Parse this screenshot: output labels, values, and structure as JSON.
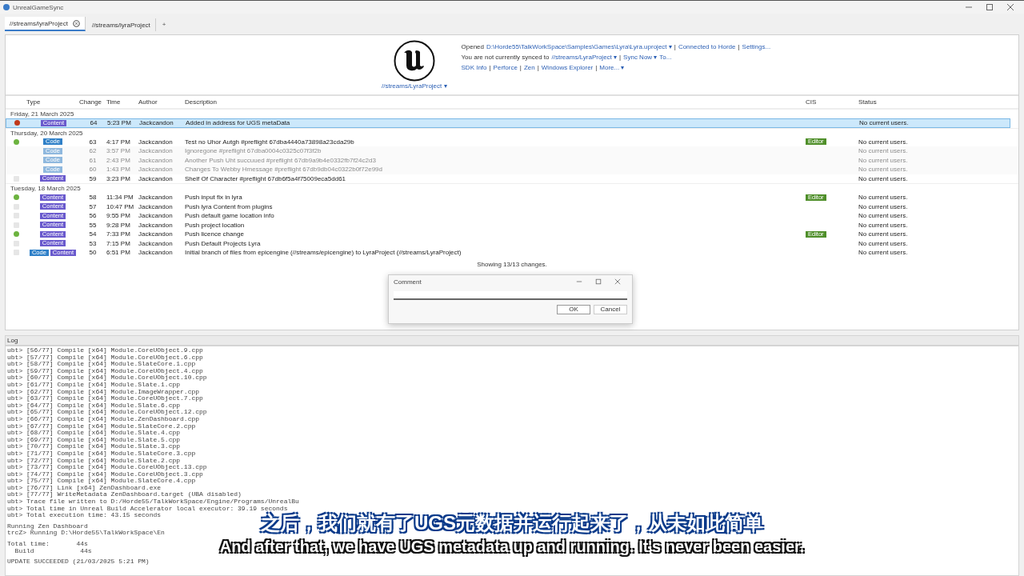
{
  "window": {
    "title": "UnrealGameSync"
  },
  "tabs": [
    {
      "label": "//streams/lyraProject",
      "selected": true,
      "closable": true
    },
    {
      "label": "//streams/lyraProject",
      "selected": false,
      "closable": false
    }
  ],
  "new_tab": "+",
  "header": {
    "stream": "//streams/LyraProject ▾",
    "lines": [
      [
        {
          "text": "Opened",
          "link": false
        },
        {
          "text": "D:\\Horde55\\TalkWorkSpace\\Samples\\Games\\Lyra\\Lyra.uproject ▾",
          "link": true
        },
        {
          "text": "|",
          "link": false
        },
        {
          "text": "Connected to Horde",
          "link": true
        },
        {
          "text": "|",
          "link": false
        },
        {
          "text": "Settings...",
          "link": true
        }
      ],
      [
        {
          "text": "You are not currently synced to",
          "link": false
        },
        {
          "text": "//streams/LyraProject ▾",
          "link": true
        },
        {
          "text": "|",
          "link": false
        },
        {
          "text": "Sync Now ▾",
          "link": true
        },
        {
          "text": "To...",
          "link": true
        }
      ],
      [
        {
          "text": "SDK Info",
          "link": true
        },
        {
          "text": "|",
          "link": false
        },
        {
          "text": "Perforce",
          "link": true
        },
        {
          "text": "|",
          "link": false
        },
        {
          "text": "Zen",
          "link": true
        },
        {
          "text": "|",
          "link": false
        },
        {
          "text": "Windows Explorer",
          "link": true
        },
        {
          "text": "|",
          "link": false
        },
        {
          "text": "More... ▾",
          "link": true
        }
      ]
    ]
  },
  "table": {
    "columns": [
      "Type",
      "Change",
      "Time",
      "Author",
      "Description",
      "CIS",
      "Status"
    ],
    "groups": [
      {
        "date": "Friday, 21 March 2025",
        "rows": [
          {
            "color": "#c0391b",
            "types": [
              {
                "label": "Content",
                "kind": "content"
              }
            ],
            "change": "64",
            "time": "5:23 PM",
            "author": "Jackcandon",
            "description": "Added in address for UGS metaData",
            "status": "No current users.",
            "selected": true,
            "disabled": false
          }
        ]
      },
      {
        "date": "Thursday, 20 March 2025",
        "rows": [
          {
            "color": "#6cb33f",
            "types": [
              {
                "label": "Code",
                "kind": "code"
              }
            ],
            "change": "63",
            "time": "4:17 PM",
            "author": "Jackcandon",
            "description": "Test no Uhor Autgh #preflight 67dba4440a73898a23cda29b",
            "cis": "Editor",
            "status": "No current users.",
            "selected": false,
            "disabled": false
          },
          {
            "types": [
              {
                "label": "Code",
                "kind": "code"
              }
            ],
            "change": "62",
            "time": "3:57 PM",
            "author": "Jackcandon",
            "description": "Ignoregone #preflight 67dba0004c0325c07f3f2b",
            "status": "No current users.",
            "selected": false,
            "disabled": true
          },
          {
            "types": [
              {
                "label": "Code",
                "kind": "code"
              }
            ],
            "change": "61",
            "time": "2:43 PM",
            "author": "Jackcandon",
            "description": "Another Push Uht succuued #preflight 67db9a9b4e0332fb7f24c2d3",
            "status": "No current users.",
            "selected": false,
            "disabled": true
          },
          {
            "types": [
              {
                "label": "Code",
                "kind": "code"
              }
            ],
            "change": "60",
            "time": "1:43 PM",
            "author": "Jackcandon",
            "description": "Changes To Webby Hmessage #preflight 67db9db04c0322b0f72e99d",
            "status": "No current users.",
            "selected": false,
            "disabled": true
          },
          {
            "color": "#e6e6e6",
            "types": [
              {
                "label": "Content",
                "kind": "content"
              }
            ],
            "change": "59",
            "time": "3:23 PM",
            "author": "Jackcandon",
            "description": "Shelf Of Character #preflight 67db6f5a4f75009eca5dd61",
            "status": "No current users.",
            "selected": false,
            "disabled": false
          }
        ]
      },
      {
        "date": "Tuesday, 18 March 2025",
        "rows": [
          {
            "color": "#6cb33f",
            "types": [
              {
                "label": "Content",
                "kind": "content"
              }
            ],
            "change": "58",
            "time": "11:34 PM",
            "author": "Jackcandon",
            "description": "Push input fix in lyra",
            "cis": "Editor",
            "status": "No current users.",
            "selected": false,
            "disabled": false
          },
          {
            "color": "#e6e6e6",
            "types": [
              {
                "label": "Content",
                "kind": "content"
              }
            ],
            "change": "57",
            "time": "10:47 PM",
            "author": "Jackcandon",
            "description": "Push lyra Content from plugins",
            "status": "No current users.",
            "selected": false,
            "disabled": false
          },
          {
            "color": "#e6e6e6",
            "types": [
              {
                "label": "Content",
                "kind": "content"
              }
            ],
            "change": "56",
            "time": "9:55 PM",
            "author": "Jackcandon",
            "description": "Push default game location info",
            "status": "No current users.",
            "selected": false,
            "disabled": false
          },
          {
            "color": "#e6e6e6",
            "types": [
              {
                "label": "Content",
                "kind": "content"
              }
            ],
            "change": "55",
            "time": "9:28 PM",
            "author": "Jackcandon",
            "description": "Push project location",
            "status": "No current users.",
            "selected": false,
            "disabled": false
          },
          {
            "color": "#6cb33f",
            "types": [
              {
                "label": "Content",
                "kind": "content"
              }
            ],
            "change": "54",
            "time": "7:33 PM",
            "author": "Jackcandon",
            "description": "Push licence change",
            "cis": "Editor",
            "status": "No current users.",
            "selected": false,
            "disabled": false
          },
          {
            "color": "#e6e6e6",
            "types": [
              {
                "label": "Content",
                "kind": "content"
              }
            ],
            "change": "53",
            "time": "7:15 PM",
            "author": "Jackcandon",
            "description": "Push Default Projects Lyra",
            "status": "No current users.",
            "selected": false,
            "disabled": false
          },
          {
            "color": "#e6e6e6",
            "types": [
              {
                "label": "Code",
                "kind": "code"
              },
              {
                "label": "Content",
                "kind": "content"
              }
            ],
            "change": "50",
            "time": "6:51 PM",
            "author": "Jackcandon",
            "description": "Initial branch of files from epicengine (//streams/epicengine) to LyraProject (//streams/LyraProject)",
            "status": "No current users.",
            "selected": false,
            "disabled": false
          }
        ]
      }
    ],
    "footer": "Showing 13/13 changes."
  },
  "dialog": {
    "title": "Comment",
    "ok": "OK",
    "cancel": "Cancel"
  },
  "log": {
    "title": "Log",
    "sections": [
      [
        "ubt> [56/77] Compile [x64] Module.CoreUObject.9.cpp",
        "ubt> [57/77] Compile [x64] Module.CoreUObject.6.cpp",
        "ubt> [58/77] Compile [x64] Module.SlateCore.1.cpp",
        "ubt> [59/77] Compile [x64] Module.CoreUObject.4.cpp",
        "ubt> [60/77] Compile [x64] Module.CoreUObject.10.cpp",
        "ubt> [61/77] Compile [x64] Module.Slate.1.cpp",
        "ubt> [62/77] Compile [x64] Module.ImageWrapper.cpp",
        "ubt> [63/77] Compile [x64] Module.CoreUObject.7.cpp",
        "ubt> [64/77] Compile [x64] Module.Slate.6.cpp",
        "ubt> [65/77] Compile [x64] Module.CoreUObject.12.cpp",
        "ubt> [66/77] Compile [x64] Module.ZenDashboard.cpp",
        "ubt> [67/77] Compile [x64] Module.SlateCore.2.cpp",
        "ubt> [68/77] Compile [x64] Module.Slate.4.cpp",
        "ubt> [69/77] Compile [x64] Module.Slate.5.cpp",
        "ubt> [70/77] Compile [x64] Module.Slate.3.cpp",
        "ubt> [71/77] Compile [x64] Module.SlateCore.3.cpp",
        "ubt> [72/77] Compile [x64] Module.Slate.2.cpp",
        "ubt> [73/77] Compile [x64] Module.CoreUObject.13.cpp",
        "ubt> [74/77] Compile [x64] Module.CoreUObject.3.cpp",
        "ubt> [75/77] Compile [x64] Module.SlateCore.4.cpp",
        "ubt> [76/77] Link [x64] ZenDashboard.exe",
        "ubt> [77/77] WriteMetadata ZenDashboard.target (UBA disabled)",
        "ubt> Trace file written to D:/Horde55/TalkWorkSpace/Engine/Programs/UnrealBu",
        "ubt> Total time in Unreal Build Accelerator local executor: 39.19 seconds",
        "ubt> Total execution time: 43.15 seconds"
      ],
      [
        "Running Zen Dashboard",
        "trcZ> Running D:\\Horde55\\TalkWorkSpace\\En"
      ],
      [
        "Total time:       44s",
        "  Build            44s"
      ],
      [
        "UPDATE SUCCEEDED (21/03/2025 5:21 PM)"
      ]
    ]
  },
  "subtitles": {
    "chinese": "之后，我们就有了UGS元数据并运行起来了，从未如此简单",
    "english": "And after that, we have UGS metadata up and running. It's never been easier."
  }
}
